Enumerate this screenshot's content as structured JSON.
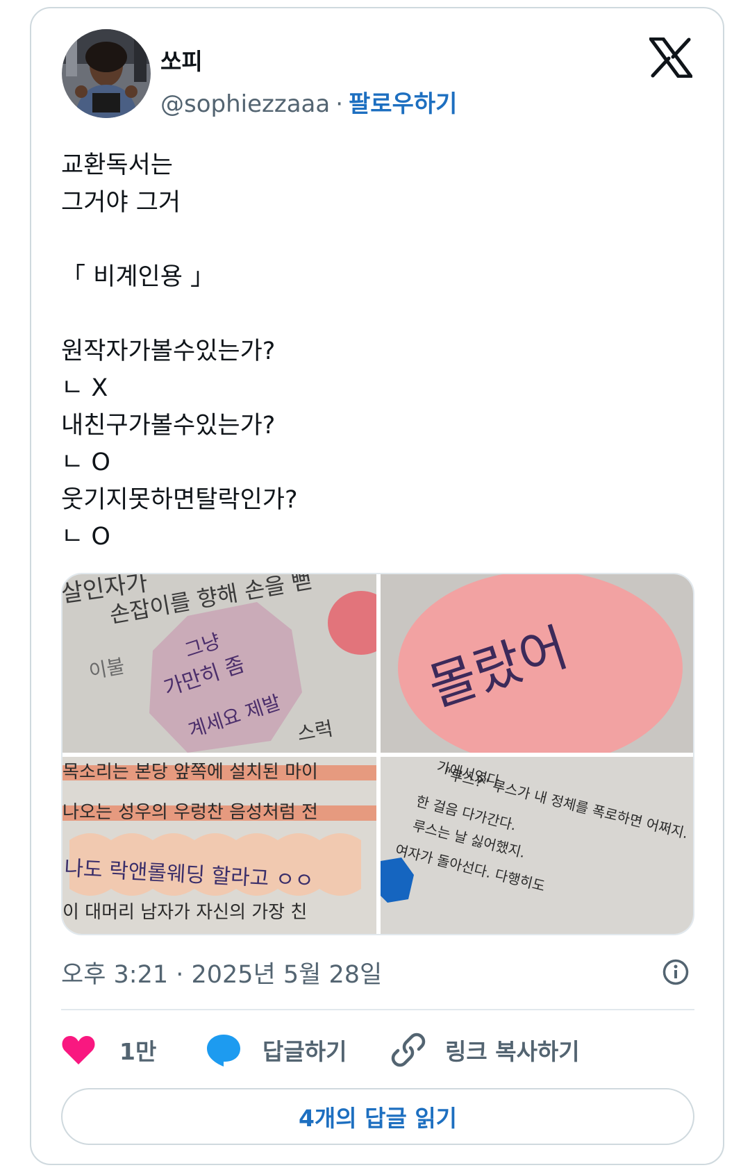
{
  "user": {
    "display_name": "쏘피",
    "handle": "@sophiezzaaa",
    "separator": "·",
    "follow_label": "팔로우하기"
  },
  "tweet": {
    "lines": "교환독서는\n그거야 그거\n\n「 비계인용 」\n\n원작자가볼수있는가?\nㄴ X\n내친구가볼수있는가?\nㄴ O\n웃기지못하면탈락인가?\nㄴ O"
  },
  "media": {
    "images": [
      {
        "note": [
          "그냥",
          "가만히 좀",
          "계세요 제발"
        ],
        "book_text": [
          "살인자가",
          "손잡이를 향해 손을 뻗",
          "이불",
          "스럭"
        ]
      },
      {
        "note": [
          "몰랐어"
        ]
      },
      {
        "note": [
          "나도 락앤롤웨딩 할라고 ㅇㅇ"
        ],
        "book_text": [
          "목소리는 본당 앞쪽에 설치된 마이",
          "나오는 성우의 우렁찬 음성처럼 전",
          "이 대머리 남자가 자신의 가장 친"
        ]
      },
      {
        "book_text": [
          "가에서였다.",
          "\"루스?\" 루스가 내 정체를 폭로하면 어쩌지.",
          "한 걸음 다가간다.",
          "루스는 날 싫어했지.",
          "여자가 돌아선다. 다행히도"
        ]
      }
    ]
  },
  "meta": {
    "timestamp": "오후 3:21 · 2025년 5월 28일"
  },
  "actions": {
    "like_count": "1만",
    "reply_label": "답글하기",
    "copy_label": "링크 복사하기",
    "read_replies_label": "4개의 답글 읽기"
  },
  "colors": {
    "link_blue": "#1d6fc0",
    "like_pink": "#f91880",
    "reply_blue": "#1d9bf0",
    "secondary_gray": "#536471"
  }
}
